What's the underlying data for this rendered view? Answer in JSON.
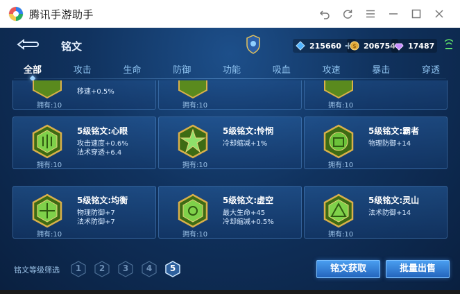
{
  "window": {
    "title": "腾讯手游助手",
    "controls": [
      "undo-icon",
      "refresh-icon",
      "menu-icon",
      "minimize-icon",
      "maximize-icon",
      "close-icon"
    ]
  },
  "header": {
    "title": "铭文",
    "currencies": [
      {
        "icon": "diamond-icon",
        "value": "215660",
        "has_plus": true
      },
      {
        "icon": "gold-coin-icon",
        "value": "206754",
        "has_plus": false
      },
      {
        "icon": "gem-crystal-icon",
        "value": "17487",
        "has_plus": false
      }
    ]
  },
  "tabs": [
    {
      "label": "全部",
      "active": true
    },
    {
      "label": "攻击",
      "active": false
    },
    {
      "label": "生命",
      "active": false
    },
    {
      "label": "防御",
      "active": false
    },
    {
      "label": "功能",
      "active": false
    },
    {
      "label": "吸血",
      "active": false
    },
    {
      "label": "攻速",
      "active": false
    },
    {
      "label": "暴击",
      "active": false
    },
    {
      "label": "穿透",
      "active": false
    }
  ],
  "cards_partial": [
    {
      "stats": [
        "移速+0.5%"
      ],
      "owned": "拥有:10"
    },
    {
      "stats": [],
      "owned": "拥有:10"
    },
    {
      "stats": [],
      "owned": "拥有:10"
    }
  ],
  "cards": [
    {
      "name": "5级铭文:心眼",
      "stats": [
        "攻击速度+0.6%",
        "法术穿透+6.4"
      ],
      "owned": "拥有:10",
      "color": "#7fd14a"
    },
    {
      "name": "5级铭文:怜悯",
      "stats": [
        "冷却缩减+1%"
      ],
      "owned": "拥有:10",
      "color": "#8ee06a"
    },
    {
      "name": "5级铭文:霸者",
      "stats": [
        "物理防御+14"
      ],
      "owned": "拥有:10",
      "color": "#6cc23a"
    },
    {
      "name": "5级铭文:均衡",
      "stats": [
        "物理防御+7",
        "法术防御+7"
      ],
      "owned": "拥有:10",
      "color": "#7fd14a"
    },
    {
      "name": "5级铭文:虚空",
      "stats": [
        "最大生命+45",
        "冷却缩减+0.5%"
      ],
      "owned": "拥有:10",
      "color": "#7fd14a"
    },
    {
      "name": "5级铭文:灵山",
      "stats": [
        "法术防御+14"
      ],
      "owned": "拥有:10",
      "color": "#7fd14a"
    }
  ],
  "filter": {
    "label": "铭文等级筛选",
    "levels": [
      "1",
      "2",
      "3",
      "4",
      "5"
    ],
    "selected": "5"
  },
  "actions": {
    "obtain_label": "铭文获取",
    "sell_label": "批量出售"
  },
  "colors": {
    "accent": "#4a9ef0",
    "gold": "#d9b04a",
    "gem_green": "#7fd14a"
  }
}
